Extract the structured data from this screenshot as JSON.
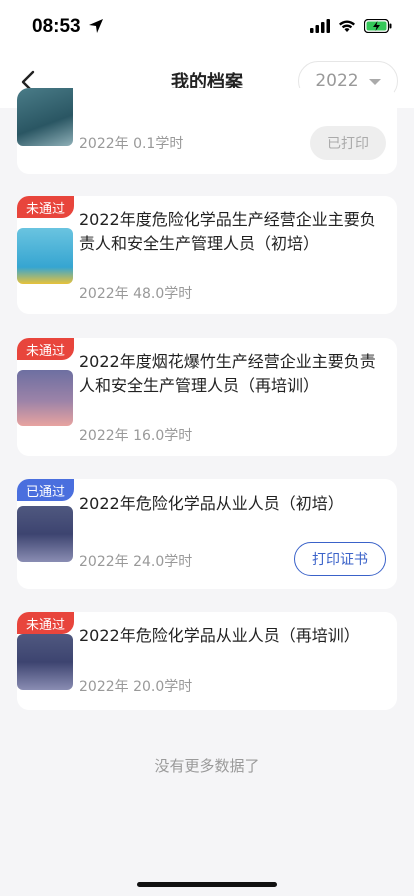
{
  "status": {
    "time": "08:53"
  },
  "nav": {
    "title": "我的档案",
    "year": "2022"
  },
  "records": [
    {
      "badge": "",
      "title": "",
      "meta": "2022年 0.1学时",
      "action": "已打印",
      "action_style": "disabled"
    },
    {
      "badge": "未通过",
      "badge_style": "fail",
      "title": "2022年度危险化学品生产经营企业主要负责人和安全生产管理人员（初培）",
      "meta": "2022年 48.0学时",
      "action": ""
    },
    {
      "badge": "未通过",
      "badge_style": "fail",
      "title": "2022年度烟花爆竹生产经营企业主要负责人和安全生产管理人员（再培训）",
      "meta": "2022年 16.0学时",
      "action": ""
    },
    {
      "badge": "已通过",
      "badge_style": "pass",
      "title": "2022年危险化学品从业人员（初培）",
      "meta": "2022年 24.0学时",
      "action": "打印证书",
      "action_style": "outline"
    },
    {
      "badge": "未通过",
      "badge_style": "fail",
      "title": "2022年危险化学品从业人员（再培训）",
      "meta": "2022年 20.0学时",
      "action": ""
    }
  ],
  "footer": {
    "no_more": "没有更多数据了"
  },
  "colors": {
    "fail": "#e8453c",
    "pass": "#4a6fde",
    "accent": "#3a62c9"
  }
}
